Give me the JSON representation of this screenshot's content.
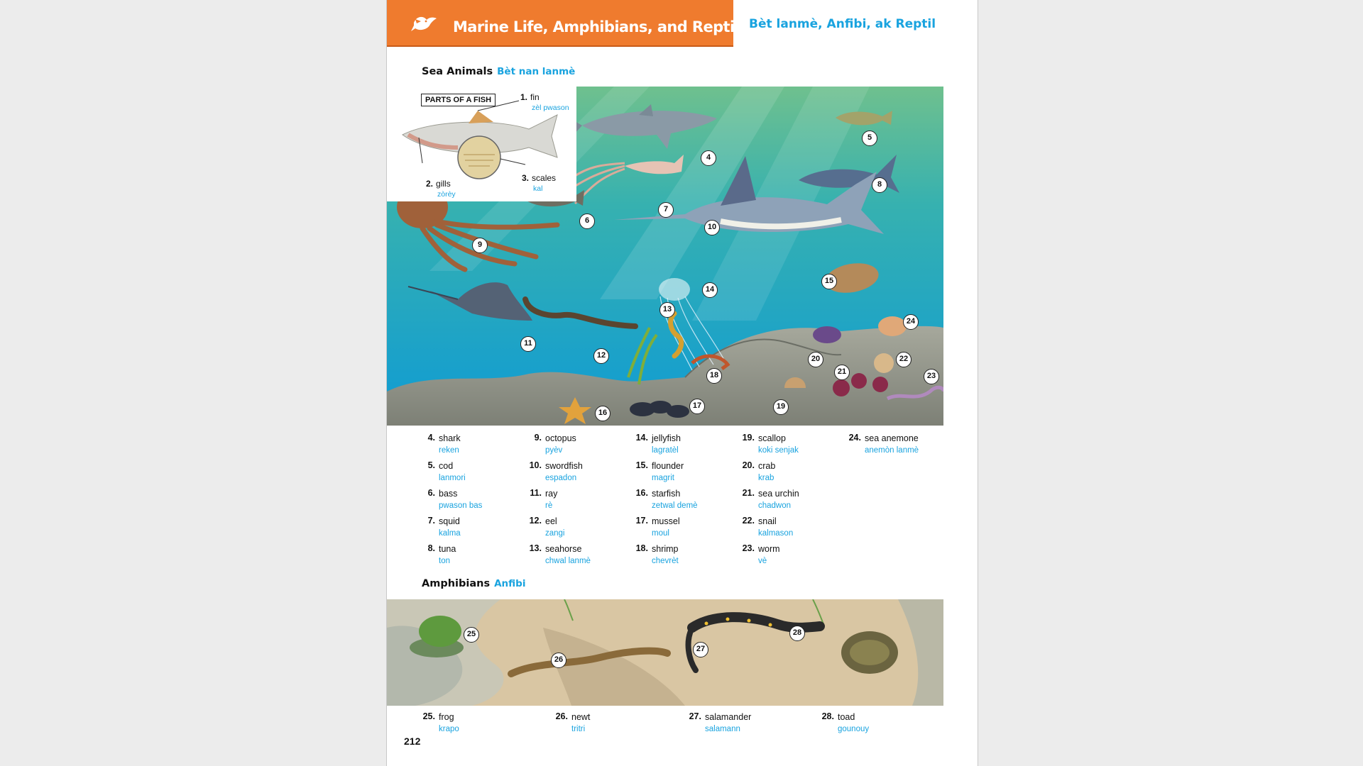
{
  "header": {
    "title": "Marine Life, Amphibians, and Reptiles",
    "subtitle": "Bèt lanmè, Anfibi, ak Reptil",
    "icon": "bird-icon",
    "accent_color": "#ef7b2e",
    "translation_color": "#19a3df"
  },
  "sea_section": {
    "heading": "Sea Animals",
    "heading_translation": "Bèt nan lanmè"
  },
  "fish_parts": {
    "box_label": "PARTS OF A FISH",
    "parts": [
      {
        "num": "1.",
        "en": "fin",
        "ht": "zèl pwason"
      },
      {
        "num": "2.",
        "en": "gills",
        "ht": "zòrèy"
      },
      {
        "num": "3.",
        "en": "scales",
        "ht": "kal"
      }
    ]
  },
  "sea_callouts": [
    "4",
    "5",
    "6",
    "7",
    "8",
    "9",
    "10",
    "11",
    "12",
    "13",
    "14",
    "15",
    "16",
    "17",
    "18",
    "19",
    "20",
    "21",
    "22",
    "23",
    "24"
  ],
  "sea_vocab": [
    {
      "num": "4.",
      "en": "shark",
      "ht": "reken"
    },
    {
      "num": "5.",
      "en": "cod",
      "ht": "lanmori"
    },
    {
      "num": "6.",
      "en": "bass",
      "ht": "pwason bas"
    },
    {
      "num": "7.",
      "en": "squid",
      "ht": "kalma"
    },
    {
      "num": "8.",
      "en": "tuna",
      "ht": "ton"
    },
    {
      "num": "9.",
      "en": "octopus",
      "ht": "pyèv"
    },
    {
      "num": "10.",
      "en": "swordfish",
      "ht": "espadon"
    },
    {
      "num": "11.",
      "en": "ray",
      "ht": "rè"
    },
    {
      "num": "12.",
      "en": "eel",
      "ht": "zangi"
    },
    {
      "num": "13.",
      "en": "seahorse",
      "ht": "chwal lanmè"
    },
    {
      "num": "14.",
      "en": "jellyfish",
      "ht": "lagratèl"
    },
    {
      "num": "15.",
      "en": "flounder",
      "ht": "magrit"
    },
    {
      "num": "16.",
      "en": "starfish",
      "ht": "zetwal demè"
    },
    {
      "num": "17.",
      "en": "mussel",
      "ht": "moul"
    },
    {
      "num": "18.",
      "en": "shrimp",
      "ht": "chevrèt"
    },
    {
      "num": "19.",
      "en": "scallop",
      "ht": "koki senjak"
    },
    {
      "num": "20.",
      "en": "crab",
      "ht": "krab"
    },
    {
      "num": "21.",
      "en": "sea urchin",
      "ht": "chadwon"
    },
    {
      "num": "22.",
      "en": "snail",
      "ht": "kalmason"
    },
    {
      "num": "23.",
      "en": "worm",
      "ht": "vè"
    },
    {
      "num": "24.",
      "en": "sea anemone",
      "ht": "anemòn lanmè"
    }
  ],
  "amph_section": {
    "heading": "Amphibians",
    "heading_translation": "Anfibi"
  },
  "amph_callouts": [
    "25",
    "26",
    "27",
    "28"
  ],
  "amph_vocab": [
    {
      "num": "25.",
      "en": "frog",
      "ht": "krapo"
    },
    {
      "num": "26.",
      "en": "newt",
      "ht": "tritri"
    },
    {
      "num": "27.",
      "en": "salamander",
      "ht": "salamann"
    },
    {
      "num": "28.",
      "en": "toad",
      "ht": "gounouy"
    }
  ],
  "page_number": "212"
}
